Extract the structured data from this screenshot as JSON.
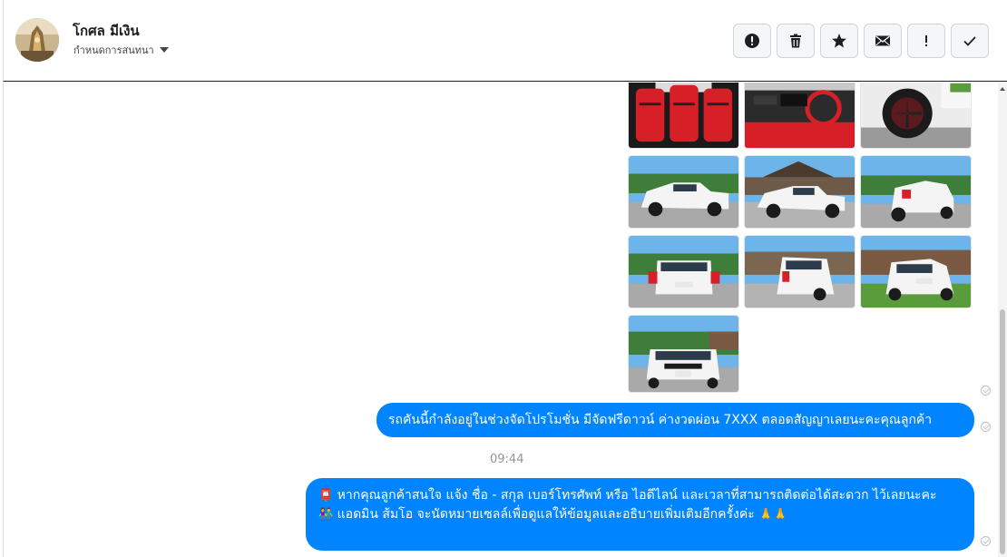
{
  "contact": {
    "name": "โกศล มีเงิน",
    "assign_label": "กำหนดการสนทนา"
  },
  "actions": [
    {
      "name": "report-button",
      "icon": "exclamation-circle-icon"
    },
    {
      "name": "delete-button",
      "icon": "trash-icon"
    },
    {
      "name": "star-button",
      "icon": "star-icon"
    },
    {
      "name": "mark-unread-button",
      "icon": "envelope-icon"
    },
    {
      "name": "important-button",
      "icon": "exclamation-icon"
    },
    {
      "name": "mark-done-button",
      "icon": "checkmark-icon"
    }
  ],
  "messages": {
    "timestamp": "09:44",
    "msg1": "รถคันนี้กำลังอยู่ในช่วงจัดโปรโมชั่น มีจัดฟรีดาวน์ ค่างวดผ่อน 7XXX ตลอดสัญญาเลยนะคะคุณลูกค้า",
    "msg2_line1_emoji": "📮",
    "msg2_line1": "หากคุณลูกค้าสนใจ แจ้ง ชื่อ - สกุล เบอร์โทรศัพท์ หรือ ไอดีไลน์ และเวลาที่สามารถติดต่อได้สะดวก ไว้เลยนะคะ",
    "msg2_line2_emoji": "👫",
    "msg2_line2": "แอดมิน ส้มโอ จะนัดหมายเซลล์เพื่อดูแลให้ข้อมูลและอธิบายเพิ่มเติมอีกครั้งค่ะ",
    "msg2_line2_end": "🙏🙏"
  },
  "colors": {
    "bubble": "#0084ff",
    "car_body": "#f4f4f4",
    "interior_red": "#d71f27",
    "sky": "#6db4ea",
    "grass": "#5a9b3c"
  }
}
